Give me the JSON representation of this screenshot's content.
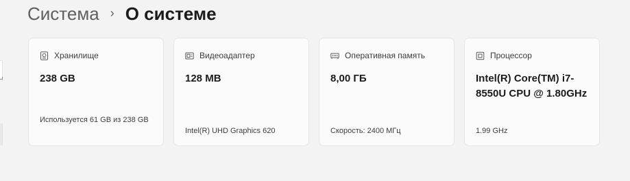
{
  "breadcrumb": {
    "parent": "Система",
    "separator": "›",
    "current": "О системе"
  },
  "cards": [
    {
      "icon": "storage-icon",
      "label": "Хранилище",
      "value": "238 GB",
      "footer": "Используется 61 GB из 238 GB"
    },
    {
      "icon": "display-adapter-icon",
      "label": "Видеоадаптер",
      "value": "128 MB",
      "footer": "Intel(R) UHD Graphics 620"
    },
    {
      "icon": "memory-icon",
      "label": "Оперативная память",
      "value": "8,00 ГБ",
      "footer": "Скорость: 2400 МГц"
    },
    {
      "icon": "processor-icon",
      "label": "Процессор",
      "value": "Intel(R) Core(TM) i7-8550U CPU @ 1.80GHz",
      "footer": "1.99 GHz"
    }
  ]
}
